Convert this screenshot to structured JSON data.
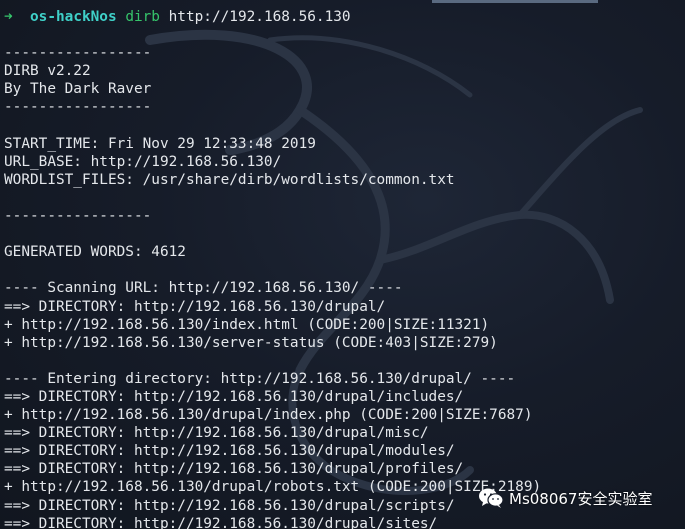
{
  "prompt": {
    "arrow": "➜",
    "directory": "os-hackNos",
    "command": "dirb",
    "argument": "http://192.168.56.130"
  },
  "output_lines": [
    "",
    "-----------------",
    "DIRB v2.22",
    "By The Dark Raver",
    "-----------------",
    "",
    "START_TIME: Fri Nov 29 12:33:48 2019",
    "URL_BASE: http://192.168.56.130/",
    "WORDLIST_FILES: /usr/share/dirb/wordlists/common.txt",
    "",
    "-----------------",
    "",
    "GENERATED WORDS: 4612",
    "",
    "---- Scanning URL: http://192.168.56.130/ ----",
    "==> DIRECTORY: http://192.168.56.130/drupal/",
    "+ http://192.168.56.130/index.html (CODE:200|SIZE:11321)",
    "+ http://192.168.56.130/server-status (CODE:403|SIZE:279)",
    "",
    "---- Entering directory: http://192.168.56.130/drupal/ ----",
    "==> DIRECTORY: http://192.168.56.130/drupal/includes/",
    "+ http://192.168.56.130/drupal/index.php (CODE:200|SIZE:7687)",
    "==> DIRECTORY: http://192.168.56.130/drupal/misc/",
    "==> DIRECTORY: http://192.168.56.130/drupal/modules/",
    "==> DIRECTORY: http://192.168.56.130/drupal/profiles/",
    "+ http://192.168.56.130/drupal/robots.txt (CODE:200|SIZE:2189)",
    "==> DIRECTORY: http://192.168.56.130/drupal/scripts/",
    "==> DIRECTORY: http://192.168.56.130/drupal/sites/"
  ],
  "watermark": {
    "icon": "wechat-icon",
    "text": "Ms08067安全实验室"
  },
  "colors": {
    "background": "#161c29",
    "text": "#e4e7eb",
    "prompt_green": "#36c46b",
    "prompt_cyan": "#3fd0c8"
  }
}
